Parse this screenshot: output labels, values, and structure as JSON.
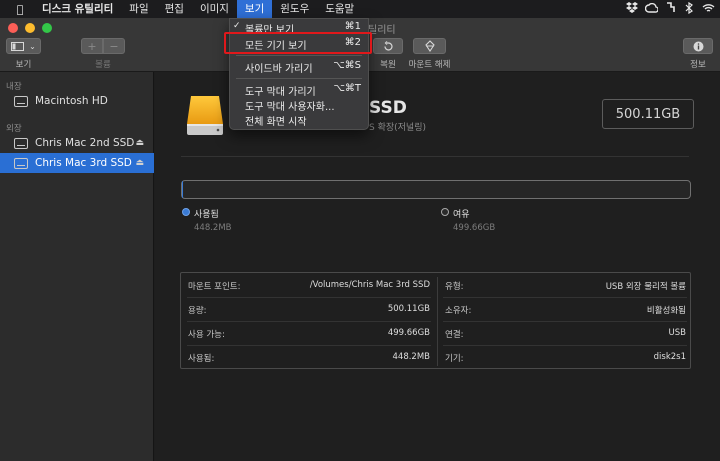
{
  "menubar": {
    "app_name": "디스크 유틸리티",
    "items": [
      "파일",
      "편집",
      "이미지",
      "보기",
      "윈도우",
      "도움말"
    ],
    "active_item": "보기"
  },
  "window": {
    "title_fragment": "틸리티"
  },
  "toolbar": {
    "view_label": "보기",
    "volume_label": "볼륨",
    "add_symbol": "+",
    "remove_symbol": "−",
    "restore_label": "복원",
    "unmount_label": "마운트 해제",
    "info_label": "정보"
  },
  "view_menu": {
    "items": [
      {
        "label": "볼륨만 보기",
        "shortcut": "⌘1",
        "checked": true
      },
      {
        "label": "모든 기기 보기",
        "shortcut": "⌘2",
        "checked": false
      },
      {
        "label": "사이드바 가리기",
        "shortcut": "⌥⌘S",
        "checked": false
      },
      {
        "label": "도구 막대 가리기",
        "shortcut": "⌥⌘T",
        "checked": false
      },
      {
        "label": "도구 막대 사용자화...",
        "shortcut": "",
        "checked": false
      },
      {
        "label": "전체 화면 시작",
        "shortcut": "",
        "checked": false
      }
    ],
    "highlight_color": "#e0181b"
  },
  "sidebar": {
    "internal_header": "내장",
    "external_header": "외장",
    "internal_items": [
      {
        "label": "Macintosh HD"
      }
    ],
    "external_items": [
      {
        "label": "Chris Mac 2nd SSD",
        "selected": false
      },
      {
        "label": "Chris Mac 3rd SSD",
        "selected": true
      }
    ],
    "eject_symbol": "⏏",
    "selection_color": "#2a6fd4"
  },
  "disk": {
    "name_fragment": "SSD",
    "subtitle_fragment": "S 확장(저널링)",
    "capacity": "500.11GB",
    "used_fraction": 0.0009,
    "used_label": "사용됨",
    "used_value": "448.2MB",
    "free_label": "여유",
    "free_value": "499.66GB",
    "used_color": "#3a7bd5"
  },
  "info": {
    "left": [
      {
        "key": "마운트 포인트:",
        "value": "/Volumes/Chris Mac 3rd SSD"
      },
      {
        "key": "용량:",
        "value": "500.11GB"
      },
      {
        "key": "사용 가능:",
        "value": "499.66GB"
      },
      {
        "key": "사용됨:",
        "value": "448.2MB"
      }
    ],
    "right": [
      {
        "key": "유형:",
        "value": "USB 외장 물리적 볼륨"
      },
      {
        "key": "소유자:",
        "value": "비활성화됨"
      },
      {
        "key": "연결:",
        "value": "USB"
      },
      {
        "key": "기기:",
        "value": "disk2s1"
      }
    ]
  }
}
